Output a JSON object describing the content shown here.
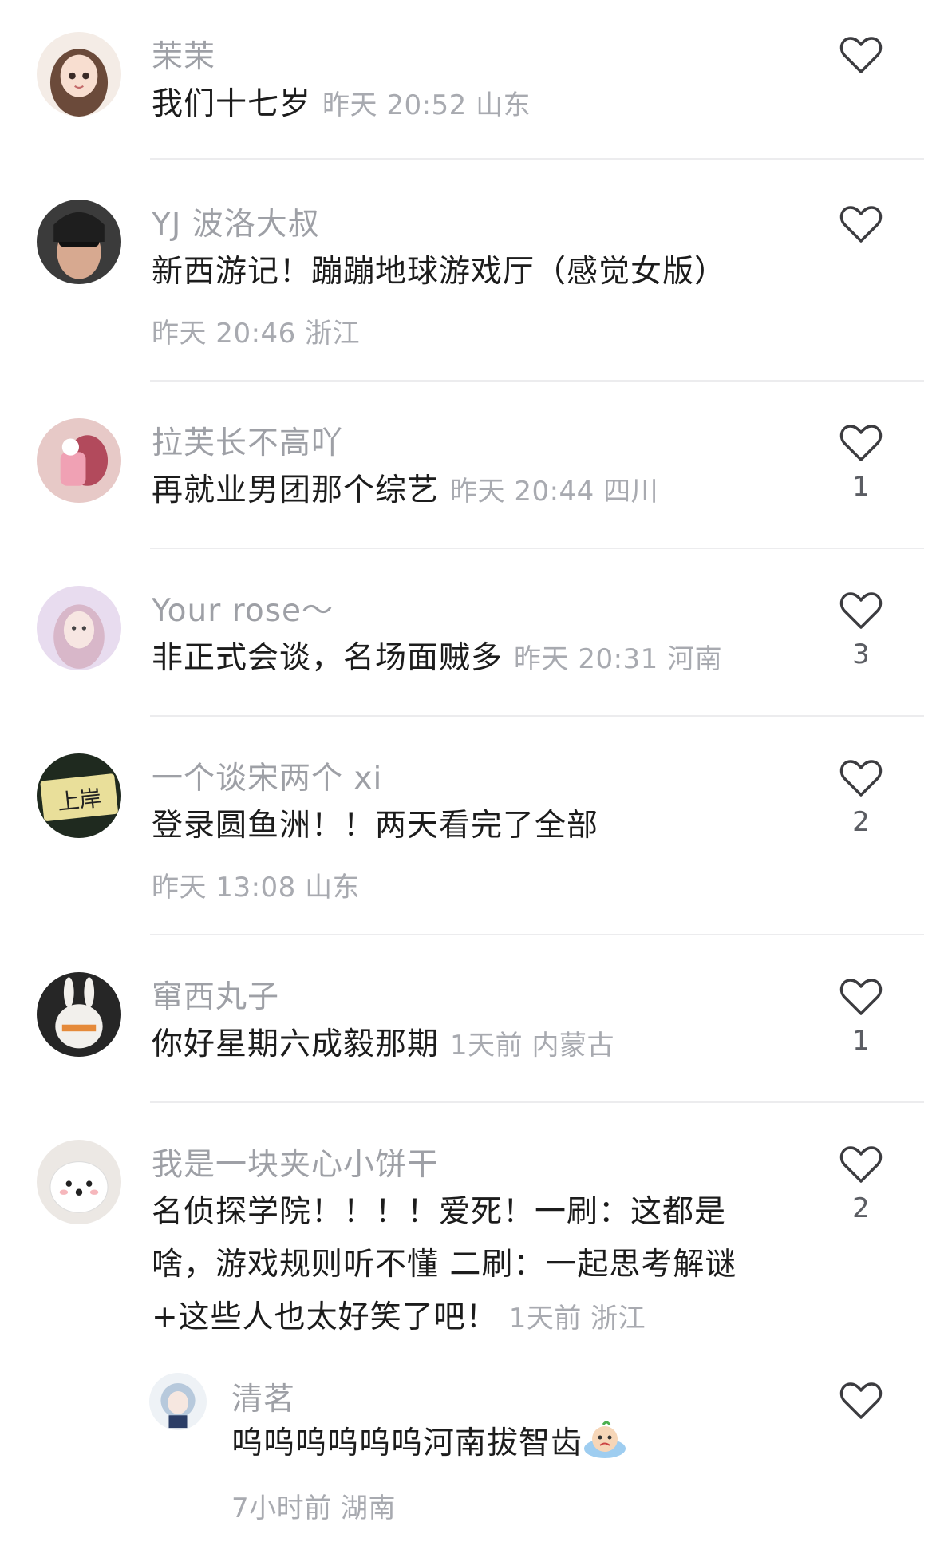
{
  "comments": [
    {
      "user": "茉茉",
      "text": "我们十七岁",
      "time": "昨天 20:52 山东",
      "likes": ""
    },
    {
      "user": "YJ 波洛大叔",
      "text": "新西游记！蹦蹦地球游戏厅（感觉女版）",
      "time": "昨天 20:46 浙江",
      "likes": ""
    },
    {
      "user": "拉芙长不高吖",
      "text": "再就业男团那个综艺",
      "time": "昨天 20:44 四川",
      "likes": "1"
    },
    {
      "user": "Your rose～",
      "text": "非正式会谈，名场面贼多",
      "time": "昨天 20:31 河南",
      "likes": "3"
    },
    {
      "user": "一个谈宋两个 xi",
      "text": "登录圆鱼洲！！两天看完了全部",
      "time": "昨天 13:08 山东",
      "likes": "2"
    },
    {
      "user": "窜西丸子",
      "text": "你好星期六成毅那期",
      "time": "1天前 内蒙古",
      "likes": "1"
    },
    {
      "user": "我是一块夹心小饼干",
      "text": "名侦探学院！！！！爱死！一刷：这都是啥，游戏规则听不懂 二刷：一起思考解谜+这些人也太好笑了吧！",
      "time": "1天前 浙江",
      "likes": "2"
    }
  ],
  "reply": {
    "user": "清茗",
    "text": "呜呜呜呜呜呜河南拔智齿",
    "time": "7小时前 湖南",
    "likes": ""
  },
  "icons": {
    "like": "heart-outline-icon",
    "emoji": "crying-emoji-icon"
  },
  "colors": {
    "username": "#9ea0a6",
    "meta": "#a8aab0",
    "text": "#1c1c1c",
    "divider": "#ececee"
  }
}
